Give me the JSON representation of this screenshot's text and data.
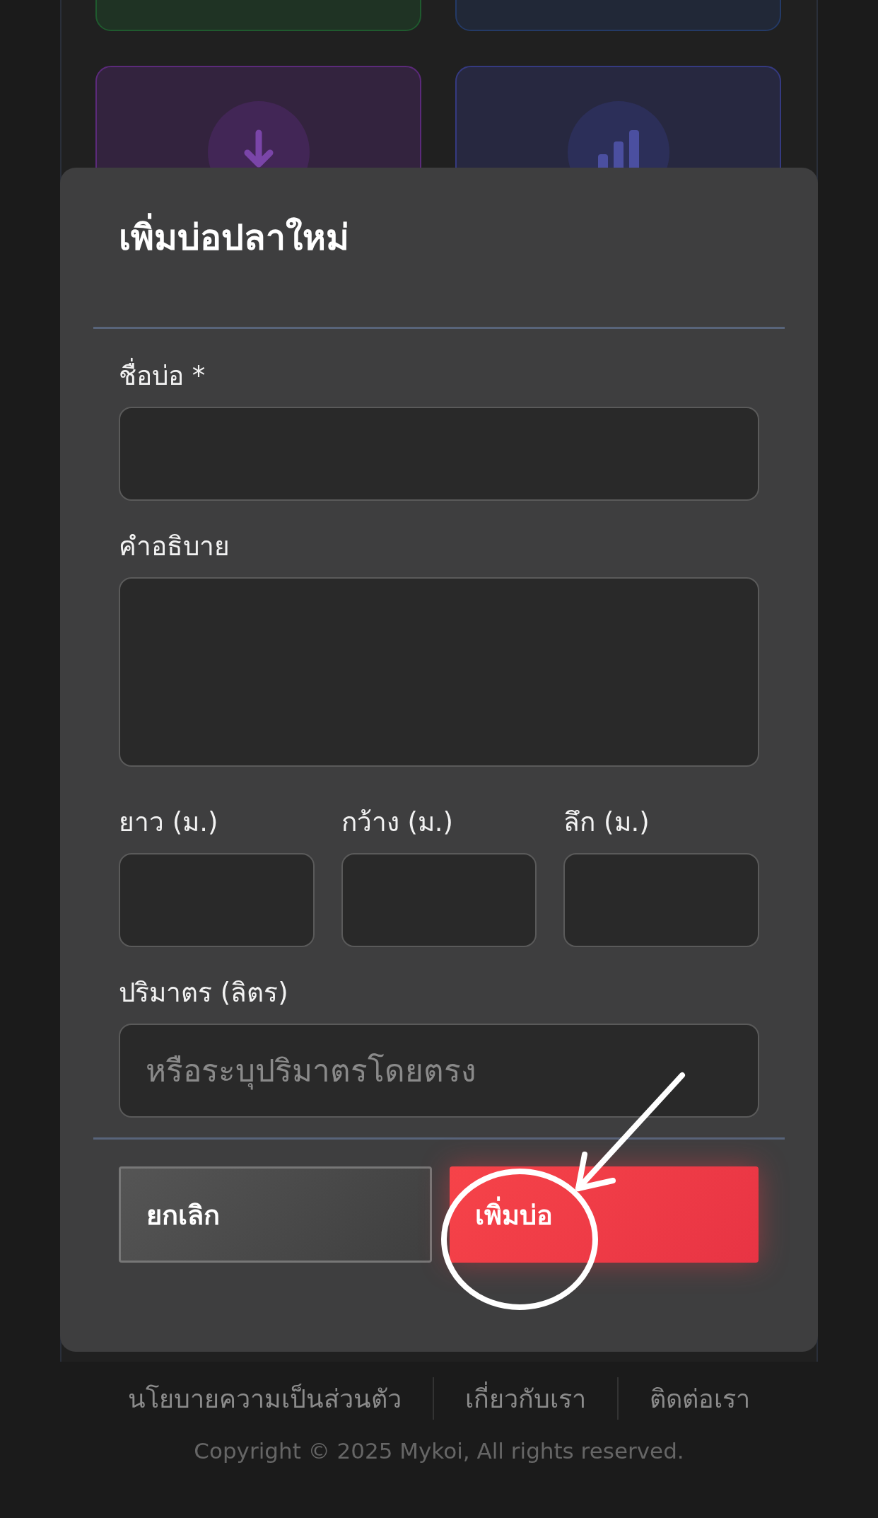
{
  "background": {
    "cards": [
      {
        "color": "#1f5a2e",
        "kind": "plain"
      },
      {
        "color": "#243a66",
        "kind": "plain"
      },
      {
        "color": "#5b2a7a",
        "kind": "download"
      },
      {
        "color": "#353a80",
        "kind": "chart"
      }
    ]
  },
  "modal": {
    "title": "เพิ่มบ่อปลาใหม่",
    "fields": [
      {
        "kind": "text",
        "label": "ชื่อบ่อ *"
      },
      {
        "kind": "textarea",
        "label": "คำอธิบาย"
      },
      {
        "kind": "row",
        "items": [
          {
            "label": "ยาว (ม.)"
          },
          {
            "label": "กว้าง (ม.)"
          },
          {
            "label": "ลึก (ม.)"
          }
        ]
      },
      {
        "kind": "text",
        "label": "ปริมาตร (ลิตร)",
        "placeholder": "หรือระบุปริมาตรโดยตรง"
      }
    ],
    "buttons": [
      {
        "kind": "secondary",
        "label": "ยกเลิก"
      },
      {
        "kind": "primary",
        "label": "เพิ่มบ่อ"
      }
    ],
    "annotation": {
      "kind": "circle-arrow"
    }
  },
  "footer": {
    "links": [
      "นโยบายความเป็นส่วนตัว",
      "เกี่ยวกับเรา",
      "ติดต่อเรา"
    ],
    "copyright": "Copyright © 2025 Mykoi, All rights reserved."
  }
}
